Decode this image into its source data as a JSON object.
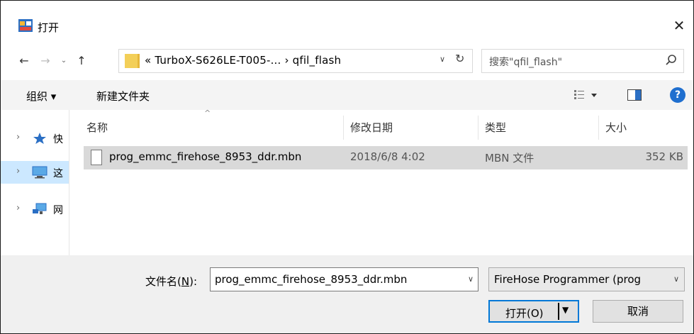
{
  "title_bar": {
    "title": "打开",
    "close_glyph": "✕"
  },
  "nav": {
    "back_glyph": "←",
    "forward_glyph": "→",
    "recent_glyph": "⌄",
    "up_glyph": "↑"
  },
  "address": {
    "path_text": "«  TurboX-S626LE-T005-...  ›  qfil_flash",
    "dropdown_glyph": "∨",
    "refresh_glyph": "↻"
  },
  "search": {
    "placeholder": "搜索\"qfil_flash\""
  },
  "toolbar": {
    "organize_label": "组织 ▾",
    "new_folder_label": "新建文件夹"
  },
  "sidebar": {
    "items": [
      {
        "label": "快",
        "icon": "star-pin-icon",
        "selected": false
      },
      {
        "label": "这",
        "icon": "computer-icon",
        "selected": true
      },
      {
        "label": "网",
        "icon": "network-icon",
        "selected": false
      }
    ],
    "chevron": "›"
  },
  "file_list": {
    "columns": [
      "名称",
      "修改日期",
      "类型",
      "大小"
    ],
    "sort_indicator": "^",
    "rows": [
      {
        "name": "prog_emmc_firehose_8953_ddr.mbn",
        "date": "2018/6/8 4:02",
        "type": "MBN 文件",
        "size": "352 KB"
      }
    ]
  },
  "footer": {
    "filename_label_prefix": "文件名(",
    "filename_label_key": "N",
    "filename_label_suffix": "):",
    "filename_value": "prog_emmc_firehose_8953_ddr.mbn",
    "filter_value": "FireHose Programmer (prog",
    "open_label": "打开(O)",
    "cancel_label": "取消"
  },
  "colors": {
    "accent": "#0078d7",
    "selected_row": "#d9d9d9",
    "nav_selected": "#cce8ff",
    "folder": "#f3cf58"
  }
}
